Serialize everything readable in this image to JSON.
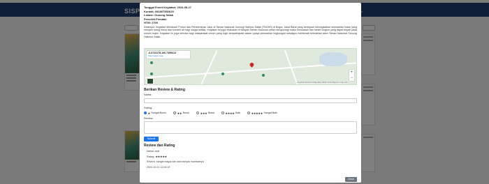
{
  "background": {
    "brand": "SISP",
    "nav_link": "Logout"
  },
  "modal": {
    "date_label": "Tanggal Event Kegiatan: 2024-08-27",
    "contact_label": "Kontak: 081807852625",
    "location_label": "Lokasi: Gunung Salak",
    "organizer_label": "Penerbit Pendaki",
    "htm_label": "HTM: 2700",
    "description": "Deskripsi: Kegiatan Menanam Pohon dan Pembersihan Jalur di Taman Nasional Gunung Halimun Salak (TNGHS) di Bogor, Jawa Barat yang bertujuan meningkatkan kelestarian hutan yang menjadi ruang hidup dan sumber air bagi warga sekitar. Kegiatan ini juga dilakukan di wilayah Taman Nasional untuk mengurangi resiko kerusakan dan tanah longsor yang dapat terjadi pada musim hujan. Kegiatan ini juga terbuka bagi masyarakat umum yang ingin berpartisipasi dalam upaya pelestarian lingkungan sekaligus menikmati keindahan alam Taman Nasional Gunung Halimun Salak."
  },
  "map": {
    "coordinates": "-6.6723178,106.7359413",
    "view_larger": "View larger map",
    "zoom_in": "+",
    "zoom_out": "−",
    "footer": "Keyboard shortcuts   Map data ©2024   Terms   Report a map error"
  },
  "review_form": {
    "title": "Berikan Review & Rating",
    "name_label": "Nama:",
    "rating_label": "Rating:",
    "options": [
      {
        "stars": "★",
        "label": "Sangat Buruk",
        "checked": true
      },
      {
        "stars": "★★",
        "label": "Buruk",
        "checked": false
      },
      {
        "stars": "★★★",
        "label": "Biasa",
        "checked": false
      },
      {
        "stars": "★★★★",
        "label": "Baik",
        "checked": false
      },
      {
        "stars": "★★★★★",
        "label": "Sangat Baik",
        "checked": false
      }
    ],
    "review_label": "Review:",
    "submit_label": "Submit"
  },
  "reviews": {
    "title": "Review dan Rating",
    "items": [
      {
        "name": "Nama: cust",
        "rating_prefix": "Rating:",
        "rating_stars": "★★★★★",
        "text": "Review: sangat bagus dan ada banyak manfaatnya",
        "date": "2024-10-21 12:05:13"
      }
    ]
  },
  "close_label": "Close"
}
